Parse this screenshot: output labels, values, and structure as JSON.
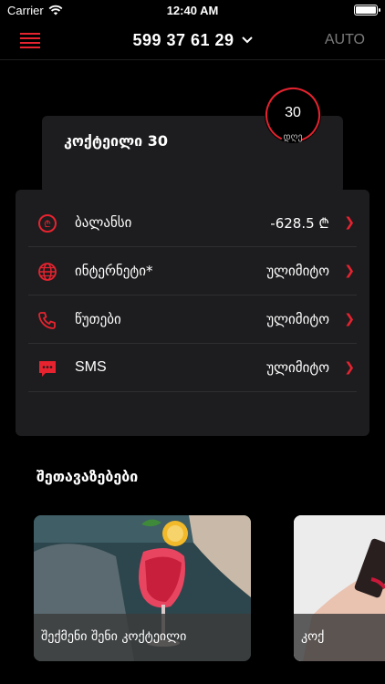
{
  "status_bar": {
    "carrier": "Carrier",
    "time": "12:40 AM"
  },
  "nav": {
    "phone_number": "599 37 61 29",
    "auto_label": "AUTO"
  },
  "plan": {
    "title": "კოქტეილი 30",
    "days_left": "30",
    "days_unit": "დღე"
  },
  "balance_rows": [
    {
      "icon": "coin-icon",
      "label": "ბალანსი",
      "value": "-628.5 ₾"
    },
    {
      "icon": "globe-icon",
      "label": "ინტერნეტი*",
      "value": "ულიმიტო"
    },
    {
      "icon": "phone-icon",
      "label": "წუთები",
      "value": "ულიმიტო"
    },
    {
      "icon": "chat-icon",
      "label": "SMS",
      "value": "ულიმიტო"
    }
  ],
  "offers": {
    "title": "შეთავაზებები",
    "items": [
      {
        "caption": "შექმენი შენი კოქტეილი"
      },
      {
        "caption": "კოქ"
      }
    ]
  },
  "colors": {
    "accent": "#e6232f",
    "card": "#1d1d1f",
    "background": "#000000"
  }
}
